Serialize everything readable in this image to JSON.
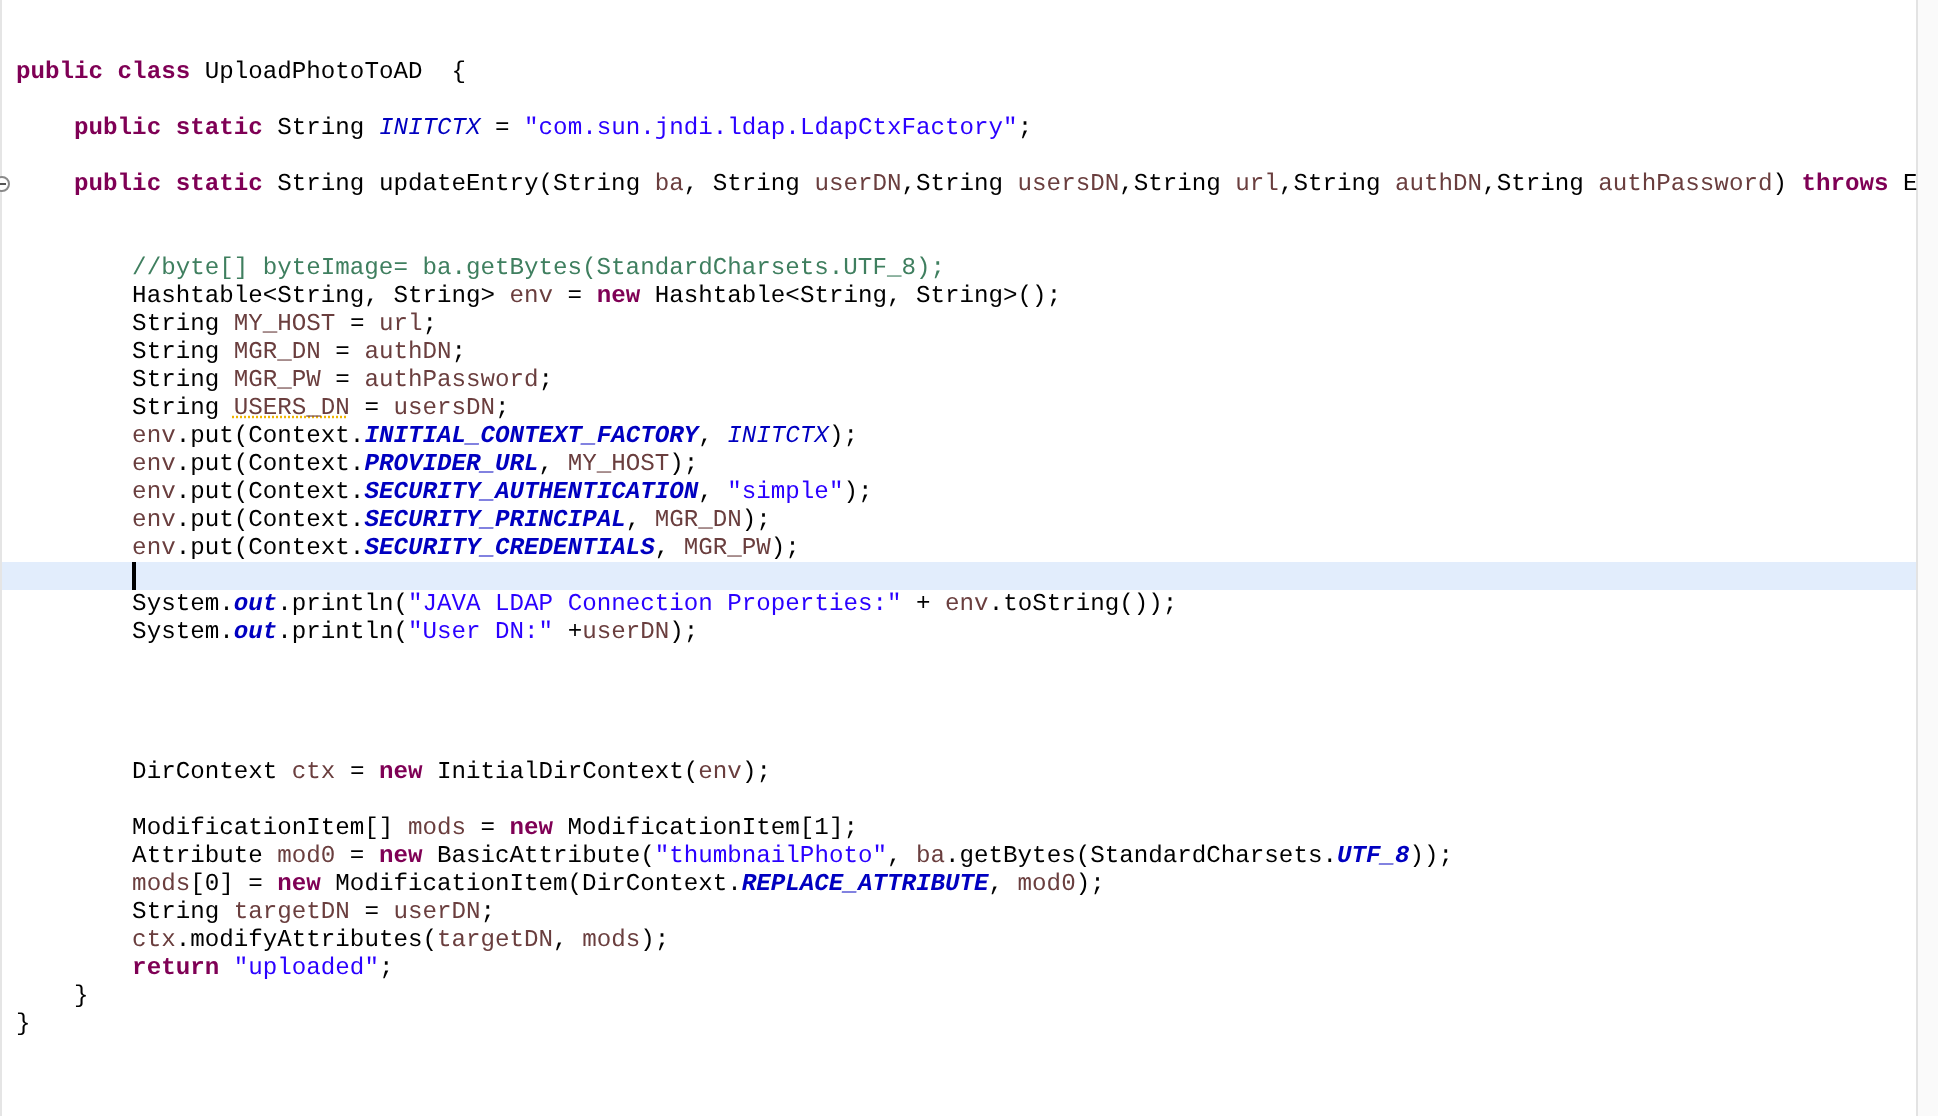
{
  "editor": {
    "lines": [
      {
        "current": false,
        "tokens": [
          {
            "kind": "keyword",
            "text": "public class "
          },
          {
            "kind": "plain",
            "text": "UploadPhotoToAD  {"
          }
        ]
      },
      {
        "current": false
      },
      {
        "current": false,
        "tokens": [
          {
            "kind": "keyword",
            "text": "    public static "
          },
          {
            "kind": "plain",
            "text": "String "
          },
          {
            "kind": "field",
            "text": "INITCTX"
          },
          {
            "kind": "plain",
            "text": " = "
          },
          {
            "kind": "string",
            "text": "\"com.sun.jndi.ldap.LdapCtxFactory\""
          },
          {
            "kind": "plain",
            "text": ";"
          }
        ]
      },
      {
        "current": false
      },
      {
        "current": false,
        "folding": true,
        "tokens": [
          {
            "kind": "keyword",
            "text": "    public static "
          },
          {
            "kind": "plain",
            "text": "String updateEntry(String "
          },
          {
            "kind": "local",
            "text": "ba"
          },
          {
            "kind": "plain",
            "text": ", String "
          },
          {
            "kind": "local",
            "text": "userDN"
          },
          {
            "kind": "plain",
            "text": ",String "
          },
          {
            "kind": "local",
            "text": "usersDN"
          },
          {
            "kind": "plain",
            "text": ",String "
          },
          {
            "kind": "local",
            "text": "url"
          },
          {
            "kind": "plain",
            "text": ",String "
          },
          {
            "kind": "local",
            "text": "authDN"
          },
          {
            "kind": "plain",
            "text": ",String "
          },
          {
            "kind": "local",
            "text": "authPassword"
          },
          {
            "kind": "plain",
            "text": ") "
          },
          {
            "kind": "keyword",
            "text": "throws"
          },
          {
            "kind": "plain",
            "text": " E"
          }
        ]
      },
      {
        "current": false
      },
      {
        "current": false
      },
      {
        "current": false,
        "tokens": [
          {
            "kind": "comment",
            "text": "        //byte[] byteImage= ba.getBytes(StandardCharsets.UTF_8);"
          }
        ]
      },
      {
        "current": false,
        "tokens": [
          {
            "kind": "plain",
            "text": "        Hashtable<String, String> "
          },
          {
            "kind": "local",
            "text": "env"
          },
          {
            "kind": "plain",
            "text": " = "
          },
          {
            "kind": "keyword",
            "text": "new"
          },
          {
            "kind": "plain",
            "text": " Hashtable<String, String>();"
          }
        ]
      },
      {
        "current": false,
        "tokens": [
          {
            "kind": "plain",
            "text": "        String "
          },
          {
            "kind": "local",
            "text": "MY_HOST"
          },
          {
            "kind": "plain",
            "text": " = "
          },
          {
            "kind": "local",
            "text": "url"
          },
          {
            "kind": "plain",
            "text": ";"
          }
        ]
      },
      {
        "current": false,
        "tokens": [
          {
            "kind": "plain",
            "text": "        String "
          },
          {
            "kind": "local",
            "text": "MGR_DN"
          },
          {
            "kind": "plain",
            "text": " = "
          },
          {
            "kind": "local",
            "text": "authDN"
          },
          {
            "kind": "plain",
            "text": ";"
          }
        ]
      },
      {
        "current": false,
        "tokens": [
          {
            "kind": "plain",
            "text": "        String "
          },
          {
            "kind": "local",
            "text": "MGR_PW"
          },
          {
            "kind": "plain",
            "text": " = "
          },
          {
            "kind": "local",
            "text": "authPassword"
          },
          {
            "kind": "plain",
            "text": ";"
          }
        ]
      },
      {
        "current": false,
        "tokens": [
          {
            "kind": "plain",
            "text": "        String "
          },
          {
            "kind": "warning",
            "text": "USERS_DN"
          },
          {
            "kind": "plain",
            "text": " = "
          },
          {
            "kind": "local",
            "text": "usersDN"
          },
          {
            "kind": "plain",
            "text": ";"
          }
        ]
      },
      {
        "current": false,
        "tokens": [
          {
            "kind": "local",
            "text": "        env"
          },
          {
            "kind": "plain",
            "text": ".put(Context."
          },
          {
            "kind": "constant",
            "text": "INITIAL_CONTEXT_FACTORY"
          },
          {
            "kind": "plain",
            "text": ", "
          },
          {
            "kind": "field",
            "text": "INITCTX"
          },
          {
            "kind": "plain",
            "text": ");"
          }
        ]
      },
      {
        "current": false,
        "tokens": [
          {
            "kind": "local",
            "text": "        env"
          },
          {
            "kind": "plain",
            "text": ".put(Context."
          },
          {
            "kind": "constant",
            "text": "PROVIDER_URL"
          },
          {
            "kind": "plain",
            "text": ", "
          },
          {
            "kind": "local",
            "text": "MY_HOST"
          },
          {
            "kind": "plain",
            "text": ");"
          }
        ]
      },
      {
        "current": false,
        "tokens": [
          {
            "kind": "local",
            "text": "        env"
          },
          {
            "kind": "plain",
            "text": ".put(Context."
          },
          {
            "kind": "constant",
            "text": "SECURITY_AUTHENTICATION"
          },
          {
            "kind": "plain",
            "text": ", "
          },
          {
            "kind": "string",
            "text": "\"simple\""
          },
          {
            "kind": "plain",
            "text": ");"
          }
        ]
      },
      {
        "current": false,
        "tokens": [
          {
            "kind": "local",
            "text": "        env"
          },
          {
            "kind": "plain",
            "text": ".put(Context."
          },
          {
            "kind": "constant",
            "text": "SECURITY_PRINCIPAL"
          },
          {
            "kind": "plain",
            "text": ", "
          },
          {
            "kind": "local",
            "text": "MGR_DN"
          },
          {
            "kind": "plain",
            "text": ");"
          }
        ]
      },
      {
        "current": false,
        "tokens": [
          {
            "kind": "local",
            "text": "        env"
          },
          {
            "kind": "plain",
            "text": ".put(Context."
          },
          {
            "kind": "constant",
            "text": "SECURITY_CREDENTIALS"
          },
          {
            "kind": "plain",
            "text": ", "
          },
          {
            "kind": "local",
            "text": "MGR_PW"
          },
          {
            "kind": "plain",
            "text": ");"
          }
        ]
      },
      {
        "current": true
      },
      {
        "current": false,
        "tokens": [
          {
            "kind": "plain",
            "text": "        System."
          },
          {
            "kind": "constant",
            "text": "out"
          },
          {
            "kind": "plain",
            "text": ".println("
          },
          {
            "kind": "string",
            "text": "\"JAVA LDAP Connection Properties:\""
          },
          {
            "kind": "plain",
            "text": " + "
          },
          {
            "kind": "local",
            "text": "env"
          },
          {
            "kind": "plain",
            "text": ".toString());"
          }
        ]
      },
      {
        "current": false,
        "tokens": [
          {
            "kind": "plain",
            "text": "        System."
          },
          {
            "kind": "constant",
            "text": "out"
          },
          {
            "kind": "plain",
            "text": ".println("
          },
          {
            "kind": "string",
            "text": "\"User DN:\""
          },
          {
            "kind": "plain",
            "text": " +"
          },
          {
            "kind": "local",
            "text": "userDN"
          },
          {
            "kind": "plain",
            "text": ");"
          }
        ]
      },
      {
        "current": false
      },
      {
        "current": false
      },
      {
        "current": false
      },
      {
        "current": false
      },
      {
        "current": false,
        "tokens": [
          {
            "kind": "plain",
            "text": "        DirContext "
          },
          {
            "kind": "local",
            "text": "ctx"
          },
          {
            "kind": "plain",
            "text": " = "
          },
          {
            "kind": "keyword",
            "text": "new"
          },
          {
            "kind": "plain",
            "text": " InitialDirContext("
          },
          {
            "kind": "local",
            "text": "env"
          },
          {
            "kind": "plain",
            "text": ");"
          }
        ]
      },
      {
        "current": false
      },
      {
        "current": false,
        "tokens": [
          {
            "kind": "plain",
            "text": "        ModificationItem[] "
          },
          {
            "kind": "local",
            "text": "mods"
          },
          {
            "kind": "plain",
            "text": " = "
          },
          {
            "kind": "keyword",
            "text": "new"
          },
          {
            "kind": "plain",
            "text": " ModificationItem[1];"
          }
        ]
      },
      {
        "current": false,
        "tokens": [
          {
            "kind": "plain",
            "text": "        Attribute "
          },
          {
            "kind": "local",
            "text": "mod0"
          },
          {
            "kind": "plain",
            "text": " = "
          },
          {
            "kind": "keyword",
            "text": "new"
          },
          {
            "kind": "plain",
            "text": " BasicAttribute("
          },
          {
            "kind": "string",
            "text": "\"thumbnailPhoto\""
          },
          {
            "kind": "plain",
            "text": ", "
          },
          {
            "kind": "local",
            "text": "ba"
          },
          {
            "kind": "plain",
            "text": ".getBytes(StandardCharsets."
          },
          {
            "kind": "constant",
            "text": "UTF_8"
          },
          {
            "kind": "plain",
            "text": "));"
          }
        ]
      },
      {
        "current": false,
        "tokens": [
          {
            "kind": "local",
            "text": "        mods"
          },
          {
            "kind": "plain",
            "text": "[0] = "
          },
          {
            "kind": "keyword",
            "text": "new"
          },
          {
            "kind": "plain",
            "text": " ModificationItem(DirContext."
          },
          {
            "kind": "constant",
            "text": "REPLACE_ATTRIBUTE"
          },
          {
            "kind": "plain",
            "text": ", "
          },
          {
            "kind": "local",
            "text": "mod0"
          },
          {
            "kind": "plain",
            "text": ");"
          }
        ]
      },
      {
        "current": false,
        "tokens": [
          {
            "kind": "plain",
            "text": "        String "
          },
          {
            "kind": "local",
            "text": "targetDN"
          },
          {
            "kind": "plain",
            "text": " = "
          },
          {
            "kind": "local",
            "text": "userDN"
          },
          {
            "kind": "plain",
            "text": ";"
          }
        ]
      },
      {
        "current": false,
        "tokens": [
          {
            "kind": "local",
            "text": "        ctx"
          },
          {
            "kind": "plain",
            "text": ".modifyAttributes("
          },
          {
            "kind": "local",
            "text": "targetDN"
          },
          {
            "kind": "plain",
            "text": ", "
          },
          {
            "kind": "local",
            "text": "mods"
          },
          {
            "kind": "plain",
            "text": ");"
          }
        ]
      },
      {
        "current": false,
        "tokens": [
          {
            "kind": "keyword",
            "text": "        return "
          },
          {
            "kind": "string",
            "text": "\"uploaded\""
          },
          {
            "kind": "plain",
            "text": ";"
          }
        ]
      },
      {
        "current": false,
        "tokens": [
          {
            "kind": "plain",
            "text": "    }"
          }
        ]
      },
      {
        "current": false,
        "tokens": [
          {
            "kind": "plain",
            "text": "}"
          }
        ]
      }
    ]
  }
}
